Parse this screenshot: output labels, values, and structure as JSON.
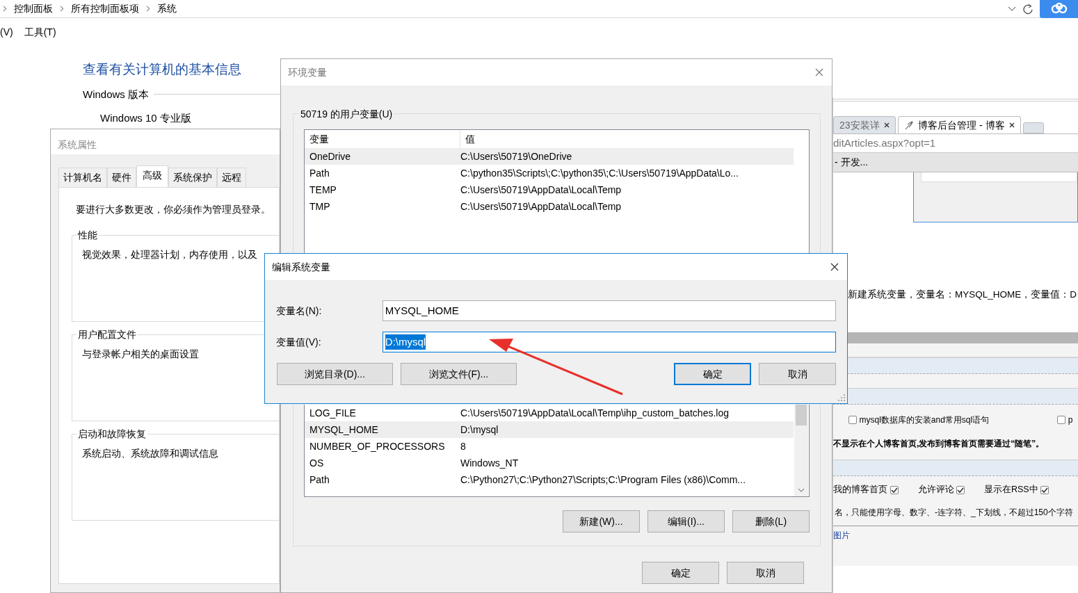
{
  "explorer": {
    "breadcrumb": [
      "控制面板",
      "所有控制面板项",
      "系统"
    ],
    "menu": [
      "(V)",
      "工具(T)"
    ]
  },
  "control_panel": {
    "heading": "查看有关计算机的基本信息",
    "section": "Windows 版本",
    "edition": "Windows 10 专业版"
  },
  "system_properties": {
    "title": "系统属性",
    "tabs": [
      {
        "label": "计算机名",
        "selected": false
      },
      {
        "label": "硬件",
        "selected": false
      },
      {
        "label": "高级",
        "selected": true
      },
      {
        "label": "系统保护",
        "selected": false
      },
      {
        "label": "远程",
        "selected": false
      }
    ],
    "notice": "要进行大多数更改，你必须作为管理员登录。",
    "groups": [
      {
        "title": "性能",
        "text": "视觉效果，处理器计划，内存使用，以及"
      },
      {
        "title": "用户配置文件",
        "text": "与登录帐户相关的桌面设置"
      },
      {
        "title": "启动和故障恢复",
        "text": "系统启动、系统故障和调试信息"
      }
    ]
  },
  "browser": {
    "tabs": [
      {
        "label": "23安装详",
        "selected": false
      },
      {
        "label": "博客后台管理 - 博客",
        "selected": true
      }
    ],
    "address": "ditArticles.aspx?opt=1",
    "bookmark": "- 开发...",
    "body_text": "新建系统变量，变量名：MYSQL_HOME，变量值：D",
    "categories": [
      {
        "label": "mysql数据库的安装and常用sql语句",
        "checked": false
      },
      {
        "label": "p",
        "checked": false
      }
    ],
    "notice": "不显示在个人博客首页,发布到博客首页需要通过“随笔”。",
    "options": [
      {
        "label": "我的博客首页",
        "checked": true
      },
      {
        "label": "允许评论",
        "checked": true
      },
      {
        "label": "显示在RSS中",
        "checked": true
      }
    ],
    "hint": "名，只能使用字母、数字、-连字符、_下划线，不超过150个字符",
    "link": "图片"
  },
  "environment_variables": {
    "title": "环境变量",
    "user_group": "50719 的用户变量(U)",
    "columns": [
      "变量",
      "值"
    ],
    "user_rows": [
      {
        "name": "OneDrive",
        "value": "C:\\Users\\50719\\OneDrive",
        "selected": true
      },
      {
        "name": "Path",
        "value": "C:\\python35\\Scripts\\;C:\\python35\\;C:\\Users\\50719\\AppData\\Lo...",
        "selected": false
      },
      {
        "name": "TEMP",
        "value": "C:\\Users\\50719\\AppData\\Local\\Temp",
        "selected": false
      },
      {
        "name": "TMP",
        "value": "C:\\Users\\50719\\AppData\\Local\\Temp",
        "selected": false
      }
    ],
    "system_rows": [
      {
        "name": "LOG_FILE",
        "value": "C:\\Users\\50719\\AppData\\Local\\Temp\\ihp_custom_batches.log",
        "selected": false
      },
      {
        "name": "MYSQL_HOME",
        "value": "D:\\mysql",
        "selected": true
      },
      {
        "name": "NUMBER_OF_PROCESSORS",
        "value": "8",
        "selected": false
      },
      {
        "name": "OS",
        "value": "Windows_NT",
        "selected": false
      },
      {
        "name": "Path",
        "value": "C:\\Python27\\;C:\\Python27\\Scripts;C:\\Program Files (x86)\\Comm...",
        "selected": false
      }
    ],
    "system_buttons": [
      "新建(W)...",
      "编辑(I)...",
      "删除(L)"
    ],
    "buttons": [
      "确定",
      "取消"
    ]
  },
  "edit_dialog": {
    "title": "编辑系统变量",
    "fields": [
      {
        "label": "变量名(N):",
        "value": "MYSQL_HOME",
        "focused": false
      },
      {
        "label": "变量值(V):",
        "value": "D:\\mysql",
        "focused": true
      }
    ],
    "buttons": [
      {
        "label": "浏览目录(D)...",
        "kind": "normal"
      },
      {
        "label": "浏览文件(F)...",
        "kind": "normal"
      },
      {
        "label": "确定",
        "kind": "default"
      },
      {
        "label": "取消",
        "kind": "normal"
      }
    ]
  }
}
